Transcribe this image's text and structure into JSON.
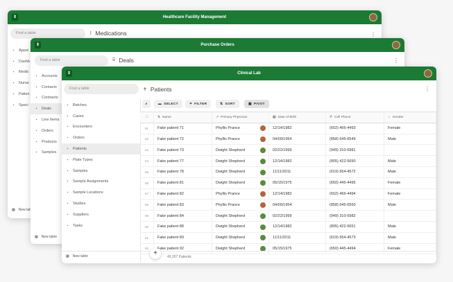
{
  "win1": {
    "title": "Healthcare Facility Management",
    "search_placeholder": "Find a table",
    "page_title": "Medications",
    "sidebar": [
      "Appoi",
      "Dashb",
      "Medic",
      "Nurse",
      "Patien",
      "Speci"
    ],
    "sidebar_icons": [
      "calendar-icon",
      "dashboard-icon",
      "pill-icon",
      "nurse-icon",
      "patient-icon",
      "specialty-icon"
    ],
    "new_table": "New table"
  },
  "win2": {
    "title": "Purchase Orders",
    "search_placeholder": "Find a table",
    "page_title": "Deals",
    "sidebar": [
      "Accounts",
      "Contacts",
      "Contracts",
      "Deals",
      "Line Items",
      "Orders",
      "Products",
      "Samples"
    ],
    "sidebar_icons": [
      "accounts-icon",
      "contacts-icon",
      "contracts-icon",
      "deals-icon",
      "line-items-icon",
      "orders-icon",
      "products-icon",
      "samples-icon"
    ],
    "new_table": "New table"
  },
  "win3": {
    "title": "Clinical Lab",
    "search_placeholder": "Find a table",
    "page_title": "Patients",
    "sidebar": [
      "Batches",
      "Cases",
      "Encounters",
      "Orders",
      "Patients",
      "Plate Types",
      "Samples",
      "Sample Assignments",
      "Sample Locations",
      "Studies",
      "Suppliers",
      "Tasks"
    ],
    "sidebar_icons": [
      "batches-icon",
      "cases-icon",
      "encounters-icon",
      "orders-icon",
      "patients-icon",
      "plate-types-icon",
      "samples-icon",
      "sample-assignments-icon",
      "sample-locations-icon",
      "studies-icon",
      "suppliers-icon",
      "tasks-icon"
    ],
    "active_sidebar": "Patients",
    "new_table": "New table",
    "toolbar": {
      "select": "SELECT",
      "filter": "FILTER",
      "sort": "SORT",
      "pivot": "PIVOT"
    },
    "columns": [
      "Name",
      "Primary Physician",
      "Date of Birth",
      "Cell Phone",
      "Gender"
    ],
    "rows": [
      {
        "num": "51",
        "name": "Fake patient 71",
        "doc": "Phyllis Prance",
        "dob": "12/14/1982",
        "phone": "(602) 466-4493",
        "gender": "Female"
      },
      {
        "num": "52",
        "name": "Fake patient 72",
        "doc": "Phyllis Prance",
        "dob": "04/09/1954",
        "phone": "(858) 645-6549",
        "gender": "Male"
      },
      {
        "num": "53",
        "name": "Fake patient 73",
        "doc": "Dwight Shepherd",
        "dob": "02/22/1999",
        "phone": "(949) 310-5981",
        "gender": ""
      },
      {
        "num": "54",
        "name": "Fake patient 77",
        "doc": "Dwight Shepherd",
        "dob": "12/14/1982",
        "phone": "(805) 422-5650",
        "gender": "Male"
      },
      {
        "num": "55",
        "name": "Fake patient 78",
        "doc": "Dwight Shepherd",
        "dob": "11/11/2011",
        "phone": "(619) 654-4572",
        "gender": "Male"
      },
      {
        "num": "56",
        "name": "Fake patient 81",
        "doc": "Dwight Shepherd",
        "dob": "05/15/1975",
        "phone": "(650) 445-4495",
        "gender": "Female"
      },
      {
        "num": "57",
        "name": "Fake patient 82",
        "doc": "Phyllis Prance",
        "dob": "12/14/1982",
        "phone": "(602) 466-4494",
        "gender": "Female"
      },
      {
        "num": "58",
        "name": "Fake patient 83",
        "doc": "Phyllis Prance",
        "dob": "04/09/1954",
        "phone": "(858) 645-6550",
        "gender": "Male"
      },
      {
        "num": "59",
        "name": "Fake patient 84",
        "doc": "Dwight Shepherd",
        "dob": "02/22/1999",
        "phone": "(949) 310-5982",
        "gender": ""
      },
      {
        "num": "60",
        "name": "Fake patient 88",
        "doc": "Dwight Shepherd",
        "dob": "12/14/1982",
        "phone": "(805) 422-5651",
        "gender": "Male"
      },
      {
        "num": "61",
        "name": "Fake patient 89",
        "doc": "Dwight Shepherd",
        "dob": "11/11/2011",
        "phone": "(619) 654-4573",
        "gender": "Male"
      },
      {
        "num": "62",
        "name": "Fake patient 92",
        "doc": "Dwight Shepherd",
        "dob": "05/15/1975",
        "phone": "(650) 445-4494",
        "gender": "Female"
      }
    ],
    "footer_count": "49,267 Patients"
  },
  "colors": {
    "brand_green": "#1b7a34",
    "avatar_phyllis": "#b5643a",
    "avatar_dwight": "#5a8a3a"
  }
}
